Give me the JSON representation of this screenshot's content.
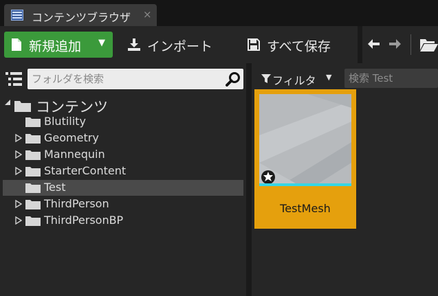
{
  "tab": {
    "title": "コンテンツブラウザ",
    "close": "×",
    "icon": "content-browser-icon"
  },
  "toolbar": {
    "add_new_label": "新規追加",
    "import_label": "インポート",
    "save_all_label": "すべて保存",
    "add_caret": "▼"
  },
  "colors": {
    "add_button": "#3b9a3b",
    "selection": "#e5a00d",
    "mesh_bar": "#35d6e6"
  },
  "left_panel": {
    "search_placeholder": "フォルダを検索",
    "root_label": "コンテンツ",
    "folders": [
      {
        "label": "Blutility",
        "expandable": false,
        "selected": false
      },
      {
        "label": "Geometry",
        "expandable": true,
        "selected": false
      },
      {
        "label": "Mannequin",
        "expandable": true,
        "selected": false
      },
      {
        "label": "StarterContent",
        "expandable": true,
        "selected": false
      },
      {
        "label": "Test",
        "expandable": false,
        "selected": true
      },
      {
        "label": "ThirdPerson",
        "expandable": true,
        "selected": false
      },
      {
        "label": "ThirdPersonBP",
        "expandable": true,
        "selected": false
      }
    ]
  },
  "right_panel": {
    "filter_label": "フィルタ",
    "filter_caret": "▼",
    "search_placeholder": "検索 Test",
    "assets": [
      {
        "name": "TestMesh",
        "type_icon": "static-mesh-icon",
        "selected": true
      }
    ]
  }
}
